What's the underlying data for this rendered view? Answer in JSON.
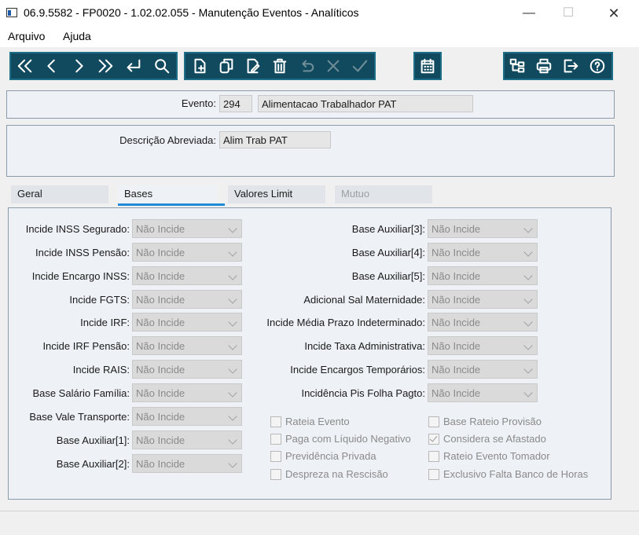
{
  "window": {
    "title": "06.9.5582 - FP0020 - 1.02.02.055 - Manutenção Eventos - Analíticos",
    "minimize_glyph": "—",
    "maximize_glyph": "☐",
    "close_glyph": "✕"
  },
  "menu": {
    "items": [
      "Arquivo",
      "Ajuda"
    ]
  },
  "toolbar": {
    "nav_icons": [
      "first-icon",
      "previous-icon",
      "next-icon",
      "last-icon",
      "return-icon",
      "search-icon"
    ],
    "edit_icons": [
      "new-record-icon",
      "copy-record-icon",
      "edit-record-icon",
      "delete-icon",
      "undo-icon",
      "cancel-icon",
      "confirm-icon"
    ],
    "extra_icons": [
      "calendar-icon"
    ],
    "right_icons": [
      "tree-icon",
      "print-icon",
      "exit-icon",
      "help-icon"
    ],
    "accent": "#114a5e"
  },
  "header": {
    "evento_label": "Evento:",
    "evento_code": "294",
    "evento_name": "Alimentacao Trabalhador PAT",
    "descricao_label": "Descrição Abreviada:",
    "descricao_value": "Alim Trab PAT"
  },
  "tabs": [
    {
      "label": "Geral",
      "active": false,
      "enabled": true
    },
    {
      "label": "Bases",
      "active": true,
      "enabled": true
    },
    {
      "label": "Valores Limit",
      "active": false,
      "enabled": true
    },
    {
      "label": "Mutuo",
      "active": false,
      "enabled": false
    }
  ],
  "bases": {
    "left": [
      {
        "label": "Incide INSS Segurado:",
        "value": "Não Incide"
      },
      {
        "label": "Incide INSS Pensão:",
        "value": "Não Incide"
      },
      {
        "label": "Incide Encargo INSS:",
        "value": "Não Incide"
      },
      {
        "label": "Incide FGTS:",
        "value": "Não Incide"
      },
      {
        "label": "Incide IRF:",
        "value": "Não Incide"
      },
      {
        "label": "Incide IRF Pensão:",
        "value": "Não Incide"
      },
      {
        "label": "Incide RAIS:",
        "value": "Não Incide"
      },
      {
        "label": "Base Salário Família:",
        "value": "Não Incide"
      },
      {
        "label": "Base Vale Transporte:",
        "value": "Não Incide"
      },
      {
        "label": "Base Auxiliar[1]:",
        "value": "Não Incide"
      },
      {
        "label": "Base Auxiliar[2]:",
        "value": "Não Incide"
      }
    ],
    "right": [
      {
        "label": "Base Auxiliar[3]:",
        "value": "Não Incide"
      },
      {
        "label": "Base Auxiliar[4]:",
        "value": "Não Incide"
      },
      {
        "label": "Base Auxiliar[5]:",
        "value": "Não Incide"
      },
      {
        "label": "Adicional Sal Maternidade:",
        "value": "Não Incide"
      },
      {
        "label": "Incide Média Prazo Indeterminado:",
        "value": "Não Incide"
      },
      {
        "label": "Incide Taxa Administrativa:",
        "value": "Não Incide"
      },
      {
        "label": "Incide Encargos Temporários:",
        "value": "Não Incide"
      },
      {
        "label": "Incidência Pis Folha Pagto:",
        "value": "Não Incide"
      }
    ],
    "checks_col1": [
      {
        "label": "Rateia Evento",
        "checked": false
      },
      {
        "label": "Paga com Líquido Negativo",
        "checked": false
      },
      {
        "label": "Previdência Privada",
        "checked": false
      },
      {
        "label": "Despreza na Rescisão",
        "checked": false
      }
    ],
    "checks_col2": [
      {
        "label": "Base Rateio Provisão",
        "checked": false
      },
      {
        "label": "Considera se Afastado",
        "checked": true
      },
      {
        "label": "Rateio Evento Tomador",
        "checked": false
      },
      {
        "label": "Exclusivo Falta Banco de Horas",
        "checked": false
      }
    ]
  }
}
